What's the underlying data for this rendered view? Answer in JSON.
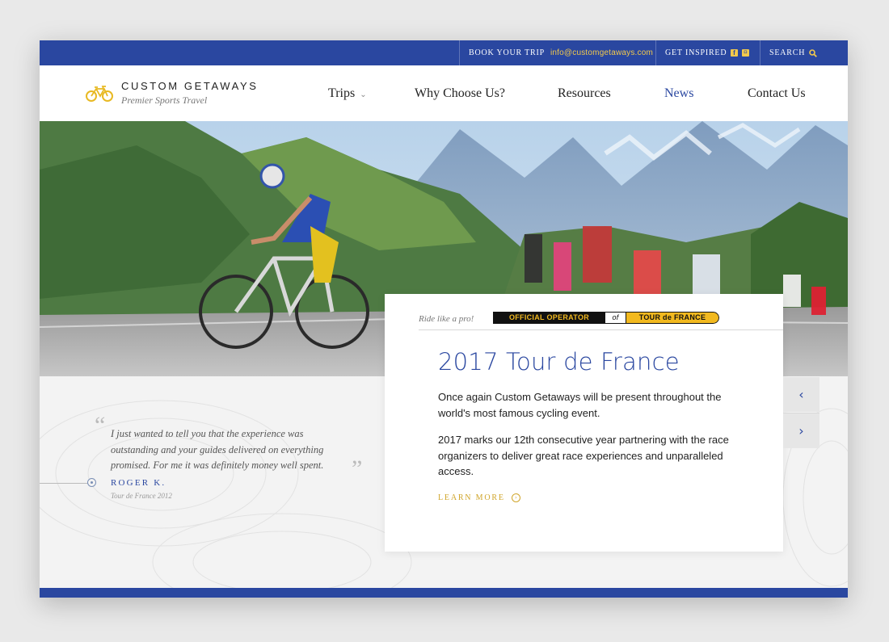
{
  "topbar": {
    "book_label": "BOOK YOUR TRIP",
    "email": "info@customgetaways.com",
    "inspired_label": "GET INSPIRED",
    "search_label": "SEARCH"
  },
  "header": {
    "brand": "CUSTOM GETAWAYS",
    "tagline": "Premier Sports Travel"
  },
  "nav": [
    {
      "label": "Trips",
      "active": false
    },
    {
      "label": "Why Choose Us?",
      "active": false
    },
    {
      "label": "Resources",
      "active": false
    },
    {
      "label": "News",
      "active": true
    },
    {
      "label": "Contact Us",
      "active": false
    }
  ],
  "testimonial": {
    "text": "I just wanted to tell you that the experience was outstanding and your guides delivered on everything promised. For me it was definitely money well spent.",
    "author": "ROGER K.",
    "trip": "Tour de France 2012"
  },
  "card": {
    "ride_label": "Ride like a pro!",
    "badge": {
      "part1": "OFFICIAL OPERATOR",
      "part2": "of",
      "part3": "TOUR de FRANCE"
    },
    "title": "2017 Tour de France",
    "p1": "Once again Custom Getaways will be present throughout the world's most famous cycling event.",
    "p2": "2017 marks our 12th consecutive year partnering with the race organizers to deliver great race experiences and unparalleled access.",
    "learn_more": "LEARN MORE"
  },
  "icons": {
    "logo": "bicycle-icon",
    "facebook": "facebook-icon",
    "instagram": "instagram-icon",
    "search": "search-icon",
    "trips_dropdown": "chevron-down-icon",
    "prev": "chevron-left-icon",
    "next": "chevron-right-icon",
    "learn_more": "arrow-circle-icon"
  },
  "colors": {
    "brand_blue": "#2a47a0",
    "accent_gold": "#f2c94c"
  }
}
